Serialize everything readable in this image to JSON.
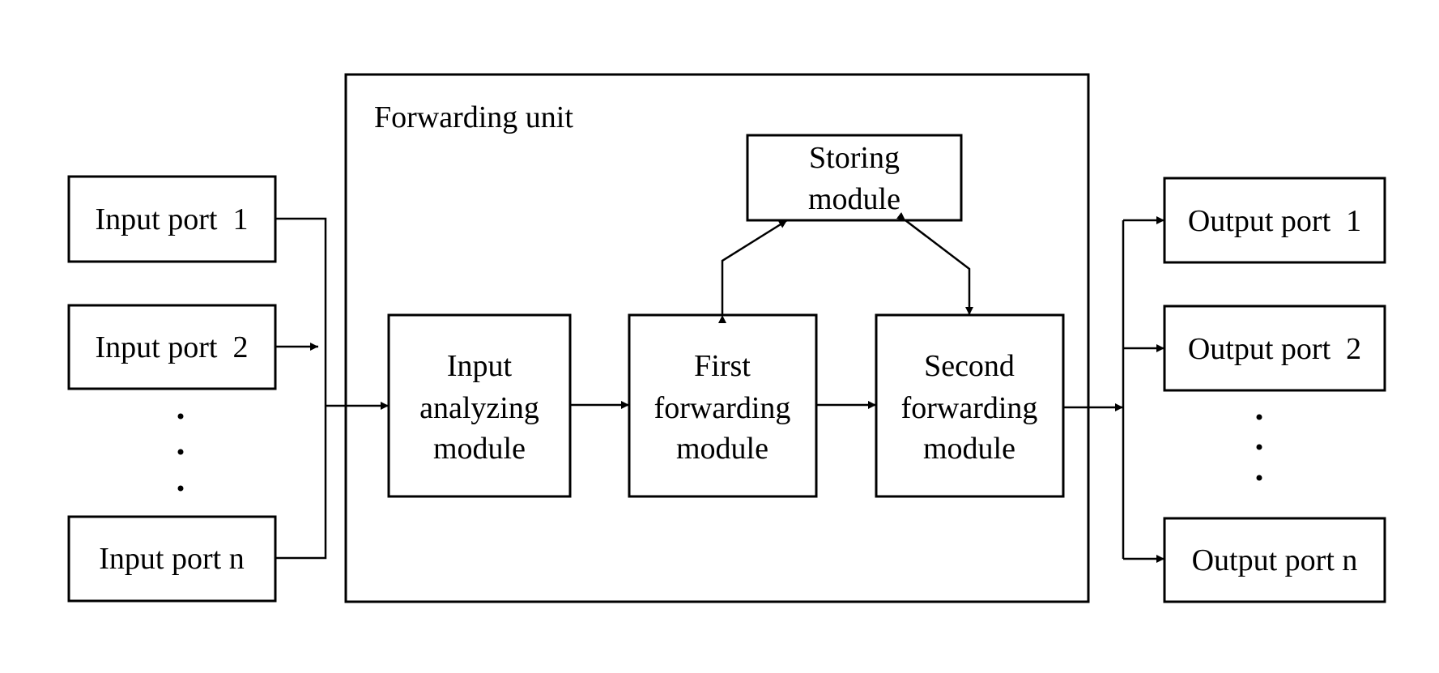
{
  "diagram": {
    "colors": {
      "line": "#000000",
      "background": "#ffffff"
    },
    "forwarding_unit": {
      "title": "Forwarding unit",
      "modules": {
        "storing": {
          "lines": [
            "Storing",
            "module"
          ]
        },
        "input_analyzing": {
          "lines": [
            "Input",
            "analyzing",
            "module"
          ]
        },
        "first_forwarding": {
          "lines": [
            "First",
            "forwarding",
            "module"
          ]
        },
        "second_forwarding": {
          "lines": [
            "Second",
            "forwarding",
            "module"
          ]
        }
      }
    },
    "input_ports": [
      {
        "label": "Input port  1"
      },
      {
        "label": "Input port  2"
      },
      {
        "label": "Input port n"
      }
    ],
    "output_ports": [
      {
        "label": "Output port  1"
      },
      {
        "label": "Output port  2"
      },
      {
        "label": "Output port n"
      }
    ],
    "ellipsis": "..."
  }
}
